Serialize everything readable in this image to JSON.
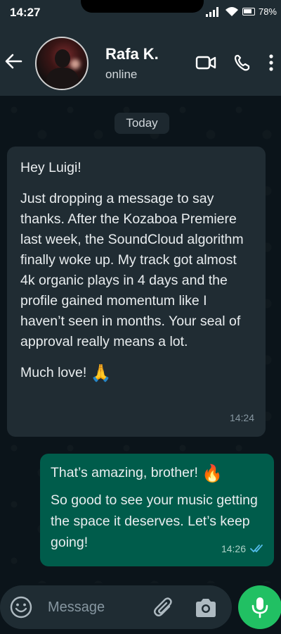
{
  "status_bar": {
    "time": "14:27",
    "battery": "78%"
  },
  "header": {
    "contact_name": "Rafa K.",
    "contact_status": "online",
    "icons": [
      "back-arrow-icon",
      "video-call-icon",
      "voice-call-icon",
      "more-options-icon"
    ]
  },
  "chat": {
    "date_chip": "Today",
    "incoming": {
      "greeting": "Hey Luigi!",
      "body": "Just dropping a message to say thanks. After the Kozaboa Premiere last week, the SoundCloud algorithm finally woke up. My track got almost 4k organic plays in 4 days and the profile gained momentum like I haven’t seen in months. Your seal of approval really means a lot.",
      "signoff": "Much love!",
      "signoff_emoji": "🙏",
      "time": "14:24"
    },
    "outgoing": {
      "line1": "That’s amazing, brother!",
      "line1_emoji": "🔥",
      "line2": "So good to see your music getting the space it deserves. Let’s keep going!",
      "time": "14:26",
      "read_status": "read-double-check-icon"
    }
  },
  "composer": {
    "placeholder": "Message",
    "icons": [
      "emoji-icon",
      "attach-icon",
      "camera-icon",
      "mic-icon"
    ]
  },
  "colors": {
    "background": "#0b141a",
    "header": "#1f2c33",
    "incoming_bubble": "#202c33",
    "outgoing_bubble": "#005c4b",
    "accent_green": "#21c063",
    "read_ticks": "#53bdeb"
  }
}
